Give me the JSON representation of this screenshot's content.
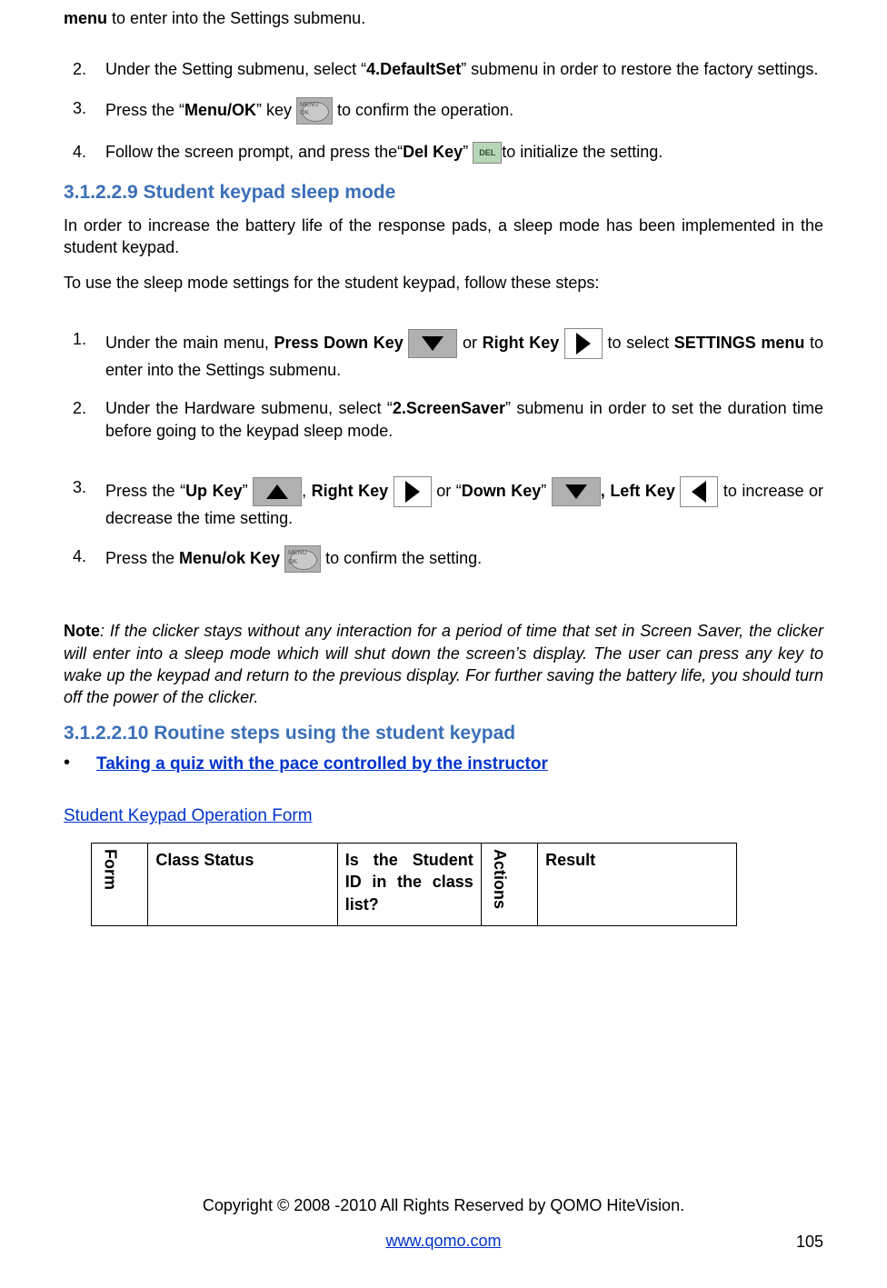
{
  "topline": {
    "bold": "menu",
    "rest": " to enter into the Settings submenu."
  },
  "list1": {
    "i2": {
      "num": "2.",
      "pre": "Under the Setting submenu, select “",
      "bold": "4.DefaultSet",
      "post": "” submenu in order to restore the factory settings."
    },
    "i3": {
      "num": "3.",
      "pre": "Press the “",
      "bold": "Menu/OK",
      "mid": "” key ",
      "post": " to confirm the operation."
    },
    "i4": {
      "num": "4.",
      "pre": "Follow the screen prompt, and press the“",
      "bold": "Del Key",
      "mid": "” ",
      "post": "to initialize the setting."
    }
  },
  "sec1_title": "3.1.2.2.9  Student keypad sleep mode",
  "sec1_para1": "In order to increase the battery life of the response pads, a sleep mode has been implemented in the student keypad.",
  "sec1_para2": "To use the sleep mode settings for the student keypad, follow these steps:",
  "list2": {
    "i1": {
      "num": "1.",
      "pre": "Under the main menu, ",
      "b1": "Press Down Key",
      "mid1": " ",
      "mid2": " or ",
      "b2": "Right Key",
      "mid3": " ",
      "post": " to select ",
      "b3": "SETTINGS menu",
      "tail": " to enter into the Settings submenu."
    },
    "i2": {
      "num": "2.",
      "pre": "Under the Hardware submenu, select “",
      "b1": "2.ScreenSaver",
      "post": "” submenu in order to set the duration time before going to the keypad sleep mode."
    },
    "i3": {
      "num": "3.",
      "pre": "Press the “",
      "b1": "Up Key",
      "q1": "” ",
      "comma1": ", ",
      "b2": "Right Key",
      "sp1": " ",
      "or": " or “",
      "b3": "Down Key",
      "q2": "” ",
      "b4": ", Left Key",
      "sp2": " ",
      "tail": " to increase or decrease the time setting."
    },
    "i4": {
      "num": "4.",
      "pre": "Press the ",
      "b1": "Menu/ok Key",
      "sp": " ",
      "post": " to confirm the setting."
    }
  },
  "note_label": "Note",
  "note_body": ": If the clicker stays without any interaction for a period of time that set in Screen Saver, the clicker will enter into a sleep mode which will shut down the screen’s display. The user can press any key to wake up the keypad and return to the previous display. For further saving the battery life, you should turn off the power of the clicker.",
  "sec2_title": "3.1.2.2.10 Routine steps using the student keypad",
  "bullet1": "Taking a quiz with the pace controlled by the instructor",
  "form_caption": "Student Keypad Operation Form",
  "table": {
    "h1": "Form",
    "h2": "Class Status",
    "h3": "Is the Student ID in the class list?",
    "h4": "Actions",
    "h5": "Result"
  },
  "del_label": "DEL",
  "footer": {
    "copyright": "Copyright © 2008 -2010 All Rights Reserved by QOMO HiteVision.",
    "url": "www.qomo.com",
    "page": "105"
  }
}
